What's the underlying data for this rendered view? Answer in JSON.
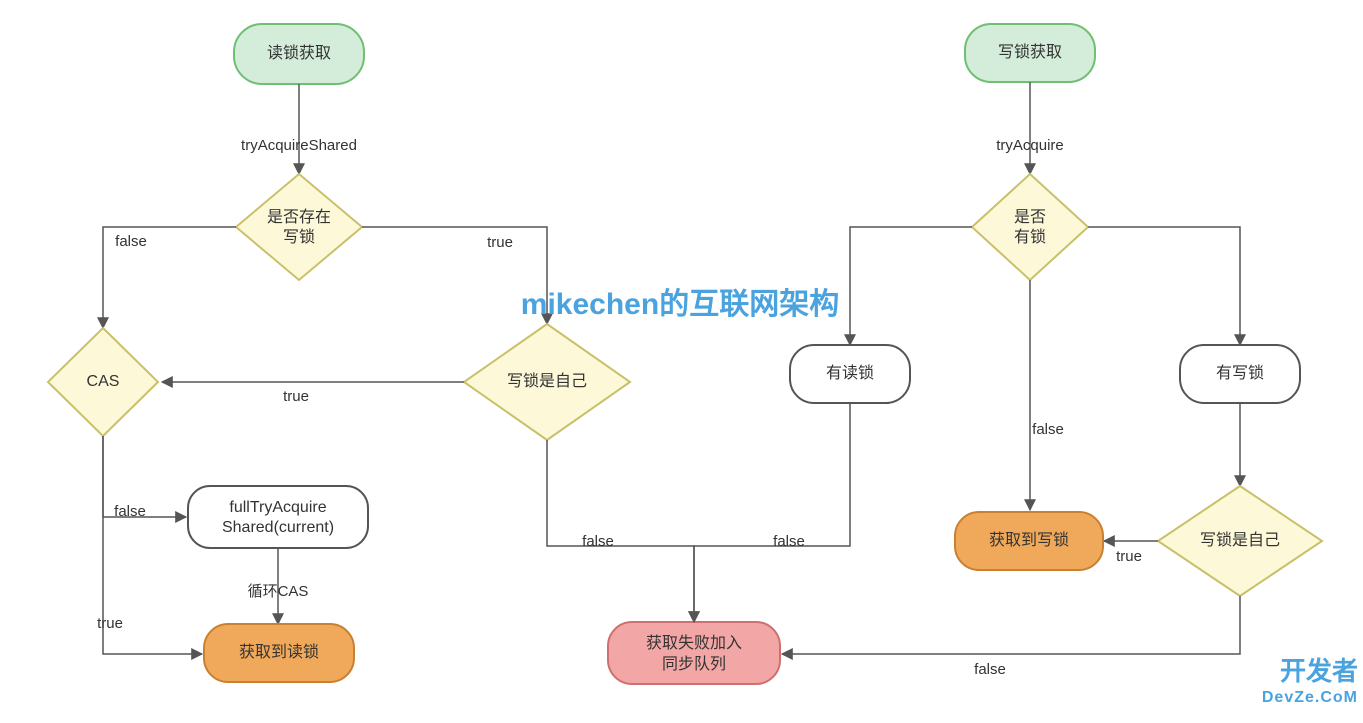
{
  "colors": {
    "green_fill": "#d4edda",
    "green_stroke": "#6fbf73",
    "yellow_fill": "#fdf9d8",
    "yellow_stroke": "#c9c06a",
    "white_fill": "#ffffff",
    "white_stroke": "#555555",
    "orange_fill": "#f0a85a",
    "orange_stroke": "#c98030",
    "red_fill": "#f2a6a6",
    "red_stroke": "#cf6f6f",
    "edge": "#555555"
  },
  "nodes": {
    "start_read": "读锁获取",
    "has_write_lock_line1": "是否存在",
    "has_write_lock_line2": "写锁",
    "cas": "CAS",
    "write_is_self_left": "写锁是自己",
    "full_try_line1": "fullTryAcquire",
    "full_try_line2": "Shared(current)",
    "got_read_lock": "获取到读锁",
    "fail_enqueue_line1": "获取失败加入",
    "fail_enqueue_line2": "同步队列",
    "start_write": "写锁获取",
    "has_lock_line1": "是否",
    "has_lock_line2": "有锁",
    "has_read_lock": "有读锁",
    "has_write_lock_right": "有写锁",
    "write_is_self_right": "写锁是自己",
    "got_write_lock": "获取到写锁"
  },
  "edges": {
    "try_acquire_shared": "tryAcquireShared",
    "try_acquire": "tryAcquire",
    "false": "false",
    "true": "true",
    "loop_cas": "循环CAS"
  },
  "watermark": "mikechen的互联网架构",
  "footer1": "开发者",
  "footer2": "DevZe.CoM"
}
